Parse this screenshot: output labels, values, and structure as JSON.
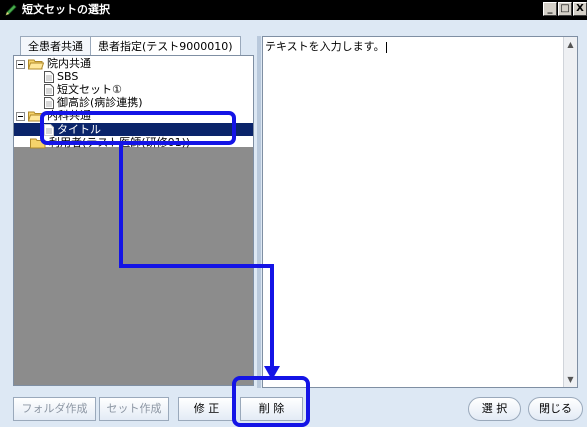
{
  "window": {
    "title": "短文セットの選択",
    "controls": [
      "_",
      "□",
      "X"
    ]
  },
  "tabs": [
    {
      "label": "全患者共通",
      "active": false
    },
    {
      "label": "患者指定(テスト9000010)",
      "active": true
    }
  ],
  "tree": {
    "items": [
      {
        "label": "院内共通",
        "type": "folder-open",
        "level": 0,
        "expander": "−"
      },
      {
        "label": "SBS",
        "type": "document",
        "level": 1
      },
      {
        "label": "短文セット①",
        "type": "document",
        "level": 1
      },
      {
        "label": "御高診(病診連携)",
        "type": "document",
        "level": 1
      },
      {
        "label": "内科共通",
        "type": "folder-open",
        "level": 0,
        "expander": "−"
      },
      {
        "label": "タイトル",
        "type": "document",
        "level": 1,
        "selected": true
      },
      {
        "label": "利用者(テスト医師(研修01))",
        "type": "folder",
        "level": 0
      }
    ]
  },
  "editor": {
    "text": "テキストを入力します。"
  },
  "buttons": {
    "folder_create": "フォルダ作成",
    "set_create": "セット作成",
    "edit": "修 正",
    "delete": "削 除",
    "select": "選 択",
    "close": "閉じる"
  },
  "colors": {
    "title_bar": "#000000",
    "selection": "#0a246a",
    "annotation": "#1414e6"
  }
}
